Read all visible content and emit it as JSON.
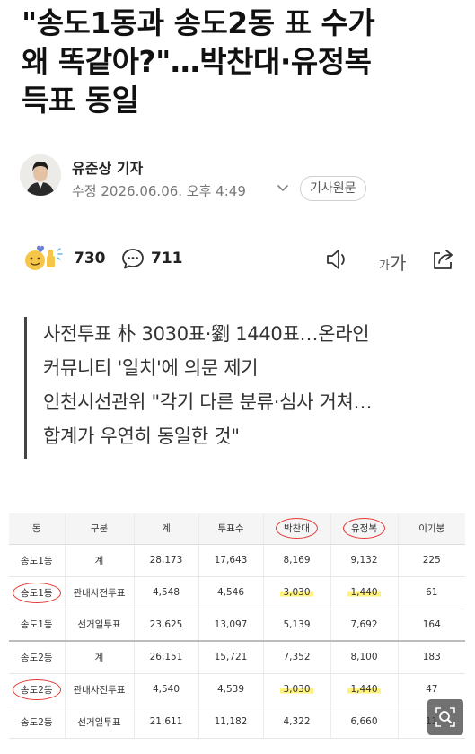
{
  "headline": {
    "line1": "\"송도1동과 송도2동 표 수가",
    "line2": "왜 똑같아?\"…박찬대·유정복",
    "line3": "득표 동일"
  },
  "byline": {
    "reporter": "유준상 기자",
    "edit_label": "수정",
    "timestamp": "2026.06.06. 오후 4:49",
    "original_button": "기사원문"
  },
  "actions": {
    "reactions_count": "730",
    "comments_count": "711",
    "font_size_small": "가",
    "font_size_large": "가"
  },
  "summary": {
    "lines": [
      "사전투표 朴 3030표·劉 1440표…온라인",
      "커뮤니티 '일치'에 의문 제기",
      "인천시선관위 \"각기 다른 분류·심사 거쳐…",
      "합계가 우연히 동일한 것\""
    ]
  },
  "table": {
    "headers": [
      "동",
      "구분",
      "계",
      "투표수",
      "박찬대",
      "유정복",
      "이기붕"
    ],
    "rows": [
      [
        "송도1동",
        "계",
        "28,173",
        "17,643",
        "8,169",
        "9,132",
        "225"
      ],
      [
        "송도1동",
        "관내사전투표",
        "4,548",
        "4,546",
        "3,030",
        "1,440",
        "61"
      ],
      [
        "송도1동",
        "선거일투표",
        "23,625",
        "13,097",
        "5,139",
        "7,692",
        "164"
      ],
      [
        "송도2동",
        "계",
        "26,151",
        "15,721",
        "7,352",
        "8,100",
        "183"
      ],
      [
        "송도2동",
        "관내사전투표",
        "4,540",
        "4,539",
        "3,030",
        "1,440",
        "47"
      ],
      [
        "송도2동",
        "선거일투표",
        "21,611",
        "11,182",
        "4,322",
        "6,660",
        "11"
      ]
    ],
    "highlight_color": "#fff27a",
    "circle_color": "#e53935"
  }
}
